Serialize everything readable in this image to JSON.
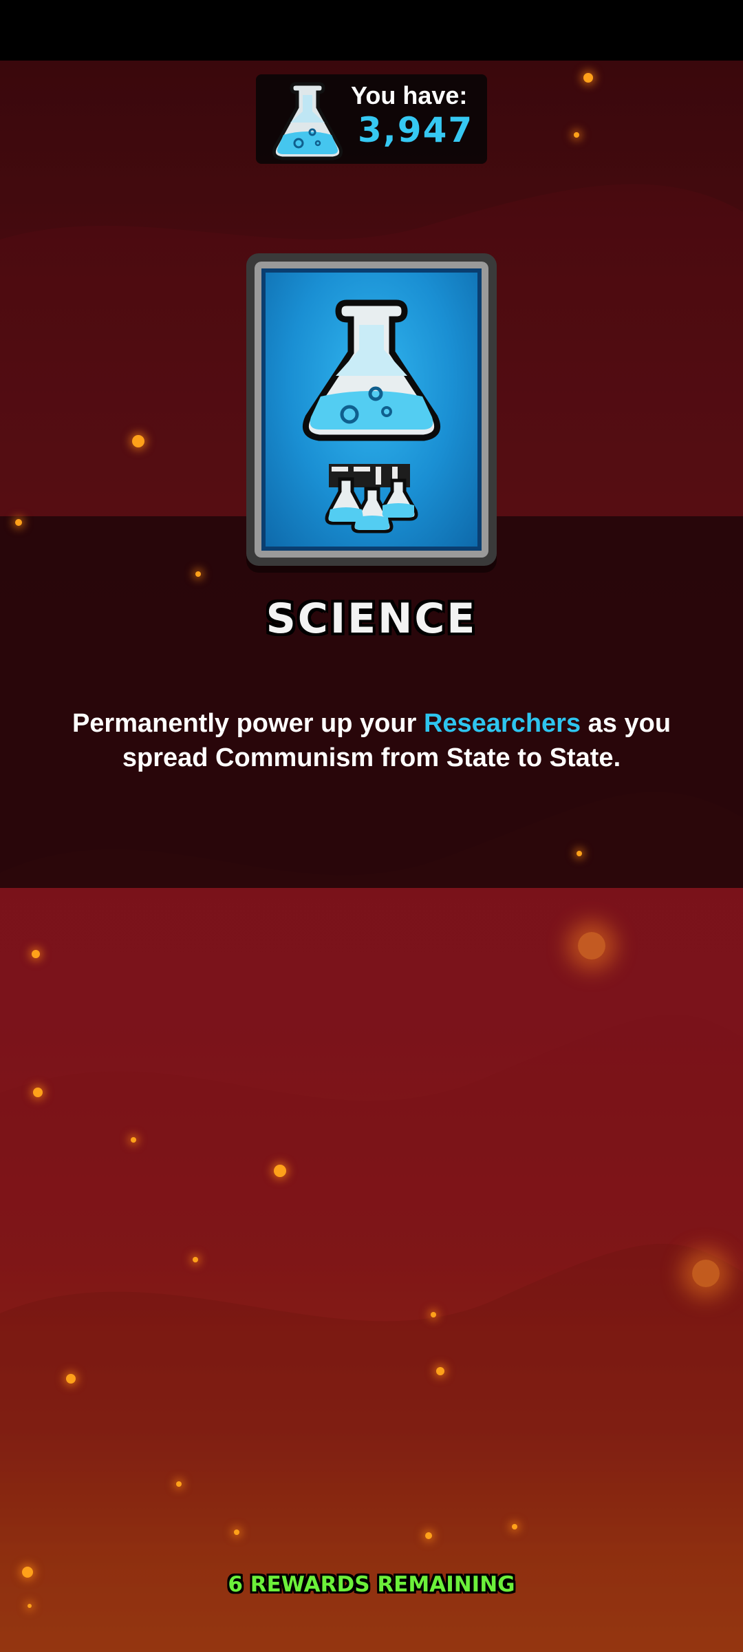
{
  "counter": {
    "label": "You have:",
    "value": "3,947",
    "icon": "science-flask-icon"
  },
  "reward": {
    "card_icon": "science-flask-card-icon",
    "title": "SCIENCE",
    "description_before": "Permanently power up your ",
    "description_highlight": "Researchers",
    "description_after": " as you spread Communism from State to State."
  },
  "footer": {
    "remaining_text": "6 REWARDS REMAINING"
  },
  "colors": {
    "accent_blue": "#36c8f2",
    "remaining_green": "#6cf03a",
    "background_red": "#6e1119"
  }
}
